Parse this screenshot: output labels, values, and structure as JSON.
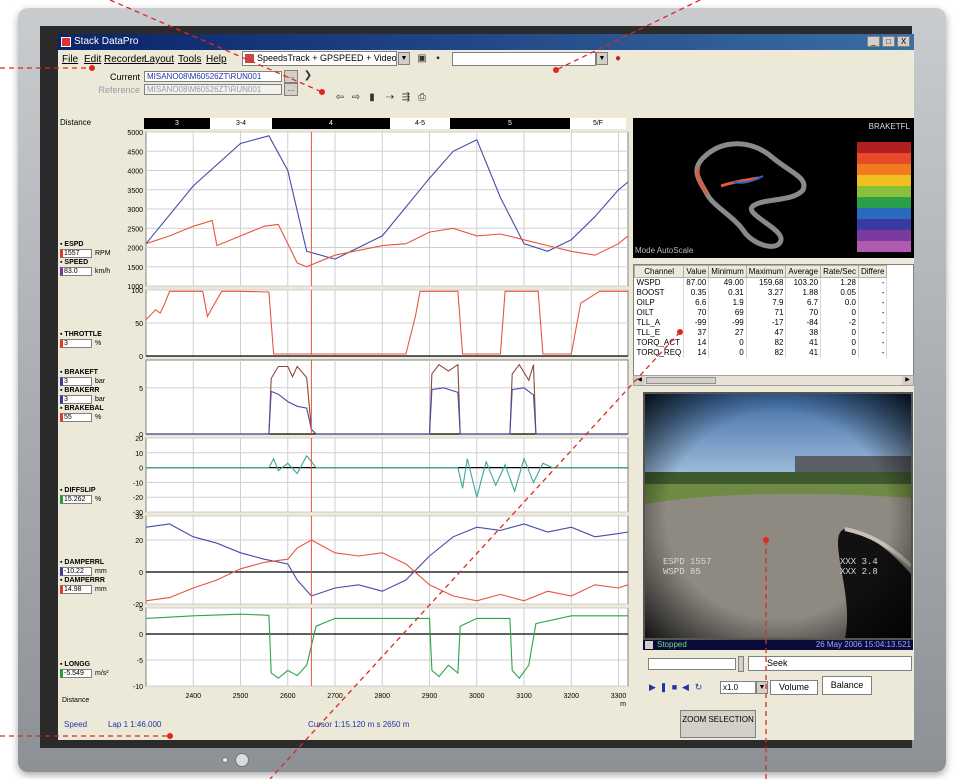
{
  "window": {
    "title": "Stack DataPro",
    "controls": [
      "_",
      "□",
      "X"
    ]
  },
  "menu": [
    "File",
    "Edit",
    "Recorder",
    "Layout",
    "Tools",
    "Help"
  ],
  "toolbar": {
    "layout": "SpeedsTrack + GPSPEED + Video"
  },
  "files": {
    "current_label": "Current",
    "current_value": "MISANO08\\M60526ZT\\RUN001",
    "reference_label": "Reference",
    "reference_value": "MISANO08\\M60526ZT\\RUN001"
  },
  "distance_bar": {
    "label": "Distance",
    "segments": [
      {
        "label": "3",
        "style": "dark"
      },
      {
        "label": "3-4",
        "style": "light"
      },
      {
        "label": "4",
        "style": "dark"
      },
      {
        "label": "4-5",
        "style": "light"
      },
      {
        "label": "5",
        "style": "dark"
      },
      {
        "label": "5/F",
        "style": "light"
      }
    ]
  },
  "colors": {
    "red": "#e8553f",
    "blue": "#4a4aa8",
    "green": "#2fa24a",
    "brown": "#8a4a3a",
    "teal": "#3aa89a"
  },
  "chart_data": {
    "type": "line",
    "x_label": "Distance",
    "x_range": [
      2300,
      3320
    ],
    "x_ticks": [
      "2400",
      "2500",
      "2600",
      "2700",
      "2800",
      "2900",
      "3000",
      "3100",
      "3200",
      "3300"
    ],
    "x_unit": "m",
    "cursor_x": 2650,
    "panels": [
      {
        "id": "espd",
        "ylim": [
          1000,
          5000
        ],
        "ticks": [
          "5000",
          "4500",
          "4000",
          "3500",
          "3000",
          "2500",
          "2000",
          "1500",
          "1000"
        ],
        "channels": [
          {
            "name": "ESPD",
            "value": "1557",
            "unit": "RPM",
            "color": "red"
          },
          {
            "name": "SPEED",
            "value": "83.0",
            "unit": "km/h",
            "color": "purple"
          }
        ],
        "series": [
          {
            "color": "blue",
            "x": [
              2300,
              2400,
              2500,
              2560,
              2600,
              2640,
              2700,
              2800,
              2900,
              2950,
              3000,
              3050,
              3100,
              3150,
              3200,
              3250,
              3300,
              3320
            ],
            "y": [
              2100,
              3600,
              4700,
              4900,
              4000,
              1900,
              1700,
              2300,
              3800,
              4500,
              4800,
              3300,
              2100,
              1900,
              2200,
              2800,
              3500,
              3700
            ]
          },
          {
            "color": "red",
            "x": [
              2300,
              2350,
              2400,
              2440,
              2450,
              2500,
              2550,
              2580,
              2600,
              2620,
              2640,
              2700,
              2800,
              2850,
              2900,
              2950,
              3000,
              3050,
              3100,
              3150,
              3200,
              3250,
              3300,
              3320
            ],
            "y": [
              2100,
              2300,
              2550,
              2700,
              2050,
              2300,
              2550,
              2600,
              2100,
              1600,
              1500,
              1800,
              2050,
              2100,
              2400,
              2500,
              2300,
              2350,
              2200,
              2050,
              1900,
              1800,
              2100,
              2300
            ]
          }
        ]
      },
      {
        "id": "throttle",
        "ylim": [
          0,
          100
        ],
        "ticks": [
          "100",
          "50",
          "0"
        ],
        "channels": [
          {
            "name": "THROTTLE",
            "value": "3",
            "unit": "%",
            "color": "red"
          }
        ],
        "series": [
          {
            "color": "red",
            "x": [
              2300,
              2320,
              2330,
              2340,
              2350,
              2420,
              2430,
              2460,
              2500,
              2560,
              2570,
              2590,
              2600,
              2640,
              2850,
              2870,
              2880,
              2900,
              2960,
              2970,
              3050,
              3060,
              3130,
              3140,
              3200,
              3220,
              3260,
              3300,
              3320
            ],
            "y": [
              55,
              70,
              65,
              80,
              98,
              98,
              60,
              98,
              98,
              97,
              3,
              3,
              3,
              3,
              3,
              60,
              98,
              98,
              98,
              3,
              3,
              98,
              98,
              3,
              3,
              80,
              98,
              98,
              98
            ]
          }
        ]
      },
      {
        "id": "brake",
        "ylim": [
          0,
          8
        ],
        "ticks": [
          "5",
          "0"
        ],
        "channels": [
          {
            "name": "BRAKEFT",
            "value": "3",
            "unit": "bar",
            "color": "blue"
          },
          {
            "name": "BRAKERR",
            "value": "3",
            "unit": "bar",
            "color": "blue"
          },
          {
            "name": "BRAKEBAL",
            "value": "55",
            "unit": "%",
            "color": "red"
          }
        ],
        "series": [
          {
            "color": "brown",
            "x": [
              2300,
              2560,
              2565,
              2580,
              2600,
              2610,
              2620,
              2640,
              2650,
              2660,
              2900,
              2905,
              2920,
              2940,
              2960,
              2965,
              3070,
              3075,
              3090,
              3110,
              3120,
              3125,
              3320
            ],
            "y": [
              0,
              0,
              6,
              7.3,
              7.3,
              6.2,
              7.3,
              6.1,
              0.5,
              0,
              0,
              6.5,
              7.5,
              6.8,
              7.5,
              0,
              0,
              6.5,
              7.5,
              5.8,
              7.5,
              0,
              0
            ]
          },
          {
            "color": "blue",
            "x": [
              2300,
              2560,
              2565,
              2580,
              2600,
              2620,
              2640,
              2650,
              2660,
              2900,
              2905,
              2930,
              2960,
              2965,
              3070,
              3075,
              3100,
              3120,
              3125,
              3320
            ],
            "y": [
              0,
              0,
              4.6,
              4.3,
              3.5,
              3,
              2.8,
              0.5,
              0,
              0,
              4.8,
              5,
              4.5,
              0,
              0,
              4.8,
              5,
              4.2,
              0,
              0
            ]
          }
        ]
      },
      {
        "id": "diffslip",
        "ylim": [
          -30,
          20
        ],
        "ticks": [
          "20",
          "10",
          "0",
          "-10",
          "-20",
          "-30"
        ],
        "channels": [
          {
            "name": "DIFFSLIP",
            "value": "15.262",
            "unit": "%",
            "color": "green"
          }
        ],
        "series": [
          {
            "color": "teal",
            "x": [
              2300,
              2560,
              2570,
              2580,
              2600,
              2620,
              2640,
              2660,
              2700,
              2960,
              2970,
              2980,
              3000,
              3020,
              3040,
              3060,
              3080,
              3100,
              3120,
              3140,
              3160,
              3320
            ],
            "y": [
              0,
              0,
              6,
              -2,
              3,
              -4,
              8,
              0,
              0,
              0,
              -14,
              6,
              -20,
              4,
              -12,
              2,
              -16,
              6,
              -10,
              3,
              0,
              0
            ]
          }
        ]
      },
      {
        "id": "damper",
        "ylim": [
          -20,
          35
        ],
        "ticks": [
          "35",
          "20",
          "0",
          "-20"
        ],
        "channels": [
          {
            "name": "DAMPERRL",
            "value": "-10.22",
            "unit": "mm",
            "color": "blue"
          },
          {
            "name": "DAMPERRR",
            "value": "14.98",
            "unit": "mm",
            "color": "red"
          }
        ],
        "series": [
          {
            "color": "blue",
            "x": [
              2300,
              2350,
              2400,
              2450,
              2500,
              2550,
              2600,
              2620,
              2650,
              2700,
              2750,
              2800,
              2850,
              2900,
              2950,
              3000,
              3050,
              3100,
              3150,
              3200,
              3250,
              3300,
              3320
            ],
            "y": [
              28,
              30,
              22,
              18,
              12,
              8,
              5,
              -5,
              -15,
              -10,
              -8,
              -12,
              -5,
              10,
              22,
              28,
              26,
              30,
              25,
              28,
              22,
              24,
              25
            ]
          },
          {
            "color": "red",
            "x": [
              2300,
              2350,
              2400,
              2450,
              2500,
              2550,
              2600,
              2620,
              2650,
              2700,
              2750,
              2800,
              2850,
              2900,
              2950,
              3000,
              3050,
              3100,
              3150,
              3200,
              3250,
              3300,
              3320
            ],
            "y": [
              -18,
              -16,
              -10,
              -5,
              2,
              6,
              8,
              15,
              20,
              12,
              10,
              12,
              5,
              -8,
              -15,
              -18,
              -14,
              -18,
              -12,
              -15,
              -8,
              -10,
              -8
            ]
          }
        ]
      },
      {
        "id": "longg",
        "ylim": [
          -10,
          5
        ],
        "ticks": [
          "5",
          "0",
          "-5",
          "-10"
        ],
        "channels": [
          {
            "name": "LONGG",
            "value": "-5.549",
            "unit": "m/s²",
            "color": "green"
          }
        ],
        "series": [
          {
            "color": "green",
            "x": [
              2300,
              2400,
              2500,
              2560,
              2565,
              2580,
              2600,
              2620,
              2640,
              2660,
              2700,
              2900,
              2905,
              2920,
              2940,
              2960,
              2965,
              3000,
              3070,
              3075,
              3090,
              3110,
              3125,
              3200,
              3320
            ],
            "y": [
              3,
              3.5,
              3.8,
              3.6,
              -7.5,
              -8.5,
              -7,
              -8,
              -6,
              1.5,
              3,
              3,
              -7,
              -8.2,
              -6,
              -7.5,
              1.5,
              3,
              3,
              -7,
              -8.5,
              -6,
              2,
              3.5,
              3.5
            ]
          }
        ]
      }
    ]
  },
  "status": {
    "speed": "Speed",
    "lap": "Lap 1 1:46.000",
    "cursor": "Cursor 1:15.120 m s 2650 m",
    "zoom": "ZOOM SELECTION"
  },
  "track_map": {
    "mode": "Mode AutoScale",
    "title": "BRAKETFL",
    "scale_colors": [
      "#b02020",
      "#e84a2a",
      "#f07a20",
      "#f0c020",
      "#8ac03a",
      "#2aa04a",
      "#2a6ac0",
      "#3a3aa0",
      "#7a3aa0",
      "#b05ab0"
    ]
  },
  "table": {
    "headers": [
      "Channel",
      "Value",
      "Minimum",
      "Maximum",
      "Average",
      "Rate/Sec",
      "Differe"
    ],
    "rows": [
      [
        "WSPD",
        "87.00",
        "49.00",
        "159.68",
        "103.20",
        "1.28",
        "-"
      ],
      [
        "BOOST",
        "0.35",
        "0.31",
        "3.27",
        "1.88",
        "0.05",
        "-"
      ],
      [
        "OILP",
        "6.6",
        "1.9",
        "7.9",
        "6.7",
        "0.0",
        "-"
      ],
      [
        "OILT",
        "70",
        "69",
        "71",
        "70",
        "0",
        "-"
      ],
      [
        "TLL_A",
        "-99",
        "-99",
        "-17",
        "-84",
        "-2",
        "-"
      ],
      [
        "TLL_E",
        "37",
        "27",
        "47",
        "38",
        "0",
        "-"
      ],
      [
        "TORQ_ACT",
        "14",
        "0",
        "82",
        "41",
        "0",
        "-"
      ],
      [
        "TORQ_REQ",
        "14",
        "0",
        "82",
        "41",
        "0",
        "-"
      ]
    ]
  },
  "video": {
    "overlay_left1": "ESPD 1557",
    "overlay_left2": "WSPD 85",
    "overlay_right1": "XXX 3.4",
    "overlay_right2": "XXX 2.8",
    "status": "Stopped",
    "date": "26 May 2006 15:04:13.521"
  },
  "playback": {
    "seek": "Seek",
    "speed": "x1.0",
    "volume": "Volume",
    "balance": "Balance"
  }
}
